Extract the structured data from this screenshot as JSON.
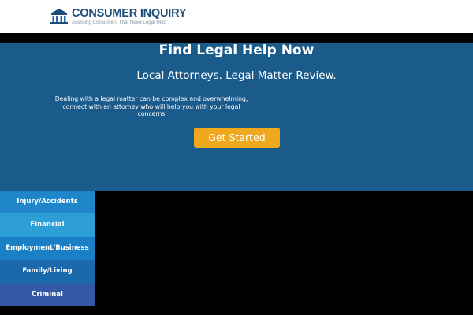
{
  "header": {
    "logo_title": "CONSUMER INQUIRY",
    "logo_tagline": "Assisting Consumers That Need Legal Help",
    "logo_icon": "courthouse-icon"
  },
  "hero": {
    "title": "Find Legal Help Now",
    "subtitle": "Local Attorneys. Legal Matter Review.",
    "description": "Dealing with a legal matter can be complex and overwhelming, connect with an attorney who will help you with your legal concerns",
    "cta_label": "Get Started"
  },
  "categories": [
    {
      "label": "Injury/Accidents",
      "color": "#1e86c9"
    },
    {
      "label": "Financial",
      "color": "#2e9fd6"
    },
    {
      "label": "Employment/Business",
      "color": "#1a7fc4"
    },
    {
      "label": "Family/Living",
      "color": "#1a6aab"
    },
    {
      "label": "Criminal",
      "color": "#3458a4"
    }
  ],
  "colors": {
    "hero_bg": "#1a5b8c",
    "cta": "#f0a81c",
    "logo": "#1f4d7a"
  }
}
